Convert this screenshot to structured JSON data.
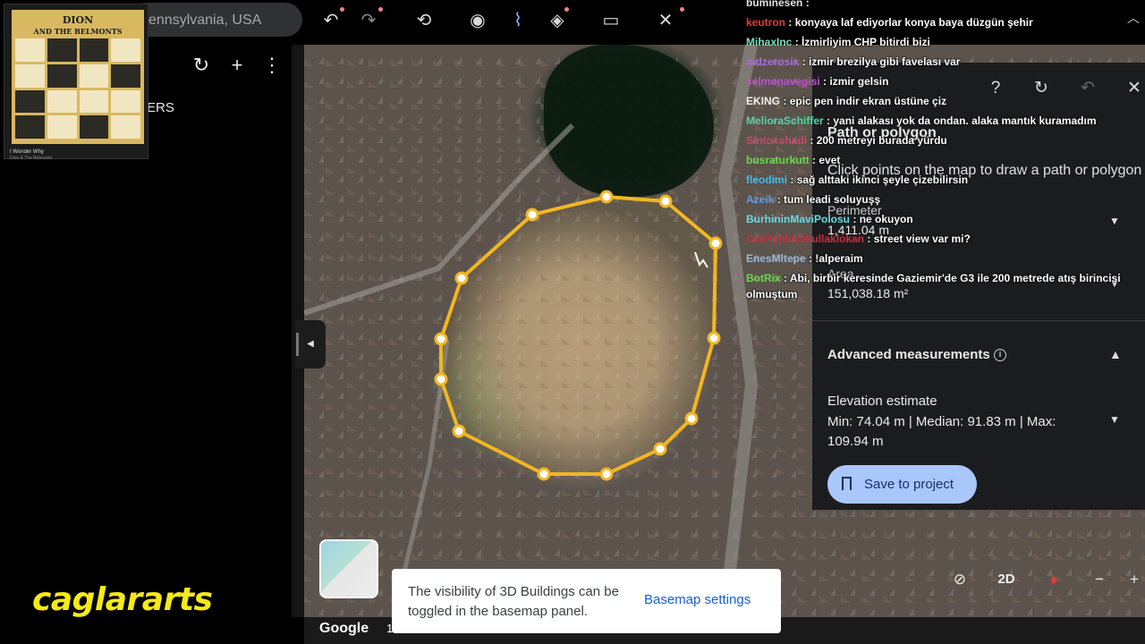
{
  "album": {
    "title_line1": "DION",
    "title_line2": "AND THE BELMONTS",
    "track": "I Wonder Why",
    "artist": "Dion & The Belmonts"
  },
  "search": {
    "value": "ennsylvania, USA"
  },
  "sidebar": {
    "projects_label": "ERS"
  },
  "watermark": "caglararts",
  "chat": [
    {
      "user": "buminesen",
      "color": "#e0e0e0",
      "msg": ""
    },
    {
      "user": "keutron",
      "color": "#e23b3b",
      "msg": "konyaya laf ediyorlar konya baya düzgün şehir"
    },
    {
      "user": "MihaxInc",
      "color": "#7de0c0",
      "msg": "İzmirliyim CHP bitirdi bizi"
    },
    {
      "user": "mdzerosix",
      "color": "#a86be0",
      "msg": "izmir brezilya gibi favelası var"
    },
    {
      "user": "selmonavegisi",
      "color": "#c050d0",
      "msg": "izmir gelsin"
    },
    {
      "user": "EKING",
      "color": "#f0f0f0",
      "msg": "epic pen indir ekran üstüne çiz"
    },
    {
      "user": "MeliorаSchiffer",
      "color": "#4fd6a8",
      "msg": "yani alakası yok da ondan. alaka mantık kuramadım"
    },
    {
      "user": "Sintoxshadi",
      "color": "#c84a6a",
      "msg": "200 metreyi burada yürdu"
    },
    {
      "user": "busraturkutt",
      "color": "#6ad84a",
      "msg": "evet"
    },
    {
      "user": "fleodimi",
      "color": "#4ab8e0",
      "msg": "sağ alttaki ikinci şeyle çizebilirsin"
    },
    {
      "user": "Azeik",
      "color": "#6a9ae0",
      "msg": "tum leadi soluyuşş"
    },
    {
      "user": "BurhininMaviPolosu",
      "color": "#6ad8e0",
      "msg": "ne okuyon"
    },
    {
      "user": "CokYanlisOkullaklokan",
      "color": "#d02a40",
      "msg": "street view var mi?"
    },
    {
      "user": "EnesMltepe",
      "color": "#9ab8d8",
      "msg": "!alperaim"
    },
    {
      "user": "BotRix",
      "color": "#6ad84a",
      "msg": "Abi, birbir keresinde Gaziemir'de G3 ile 200 metrede atış birincisi olmuştum"
    }
  ],
  "panel": {
    "title": "Path or polygon",
    "instructions": "Click points on the map to draw a path or polygon",
    "perimeter_label": "Perimeter",
    "perimeter_value": "1,411.04 m",
    "area_label": "Area",
    "area_value": "151,038.18 m²",
    "advanced_label": "Advanced measurements",
    "elevation_label": "Elevation estimate",
    "elevation_value": "Min: 74.04 m | Median: 91.83 m | Max: 109.94 m",
    "save_label": "Save to project"
  },
  "toast": {
    "text": "The visibility of 3D Buildings can be toggled in the basemap panel.",
    "link": "Basemap settings"
  },
  "map_footer": {
    "logo": "Google",
    "scale": "1"
  },
  "controls": {
    "mode": "2D"
  },
  "colors": {
    "polygon": "#f2b623",
    "accent_button": "#a9c7fa",
    "watermark": "#f5ea18"
  }
}
